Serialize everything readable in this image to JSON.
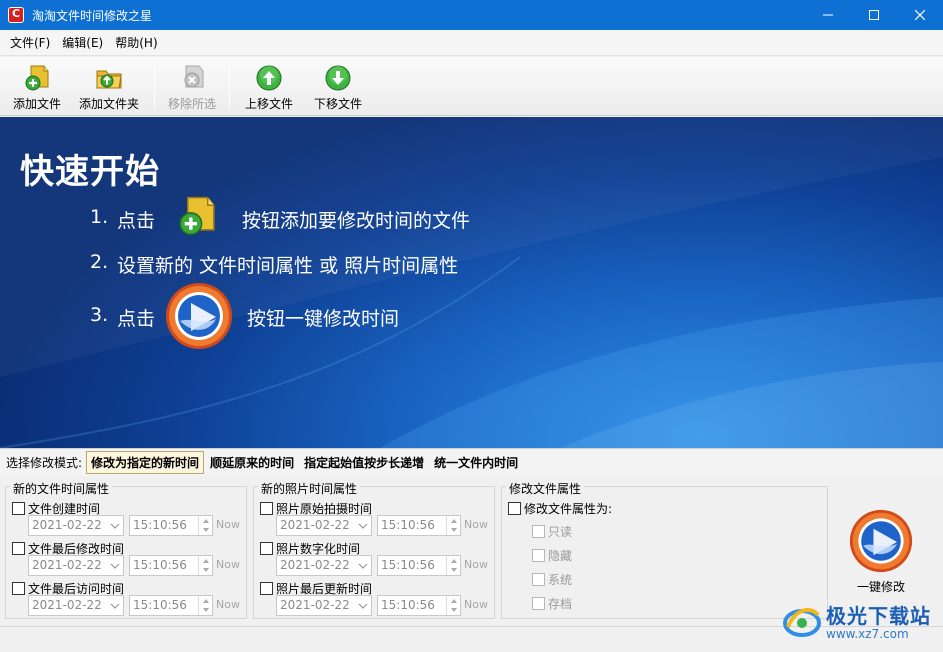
{
  "window": {
    "title": "淘淘文件时间修改之星",
    "controls": [
      "minimize",
      "maximize",
      "close"
    ]
  },
  "menu": {
    "items": [
      "文件(F)",
      "编辑(E)",
      "帮助(H)"
    ]
  },
  "toolbar": {
    "add_file": "添加文件",
    "add_folder": "添加文件夹",
    "remove_selected": "移除所选",
    "move_up": "上移文件",
    "move_down": "下移文件"
  },
  "quickstart": {
    "title": "快速开始",
    "step1_num": "1.",
    "step1_a": "点击",
    "step1_b": "按钮添加要修改时间的文件",
    "step2_num": "2.",
    "step2": "设置新的 文件时间属性 或 照片时间属性",
    "step3_num": "3.",
    "step3_a": "点击",
    "step3_b": "按钮一键修改时间"
  },
  "mode": {
    "label": "选择修改模式:",
    "tabs": [
      "修改为指定的新时间",
      "顺延原来的时间",
      "指定起始值按步长递增",
      "统一文件内时间"
    ],
    "active_index": 0
  },
  "file_time": {
    "title": "新的文件时间属性",
    "rows": [
      {
        "label": "文件创建时间",
        "date": "2021-02-22",
        "time": "15:10:56",
        "now": "Now"
      },
      {
        "label": "文件最后修改时间",
        "date": "2021-02-22",
        "time": "15:10:56",
        "now": "Now"
      },
      {
        "label": "文件最后访问时间",
        "date": "2021-02-22",
        "time": "15:10:56",
        "now": "Now"
      }
    ]
  },
  "photo_time": {
    "title": "新的照片时间属性",
    "rows": [
      {
        "label": "照片原始拍摄时间",
        "date": "2021-02-22",
        "time": "15:10:56",
        "now": "Now"
      },
      {
        "label": "照片数字化时间",
        "date": "2021-02-22",
        "time": "15:10:56",
        "now": "Now"
      },
      {
        "label": "照片最后更新时间",
        "date": "2021-02-22",
        "time": "15:10:56",
        "now": "Now"
      }
    ]
  },
  "attributes": {
    "title": "修改文件属性",
    "main_check": "修改文件属性为:",
    "options": [
      "只读",
      "隐藏",
      "系统",
      "存档"
    ]
  },
  "action": {
    "one_click": "一键修改"
  },
  "watermark": {
    "main": "极光下载站",
    "sub": "www.xz7.com"
  },
  "colors": {
    "titlebar": "#0f70d4",
    "hero": "#1a66c4",
    "active_tab": "#fdf6df"
  }
}
